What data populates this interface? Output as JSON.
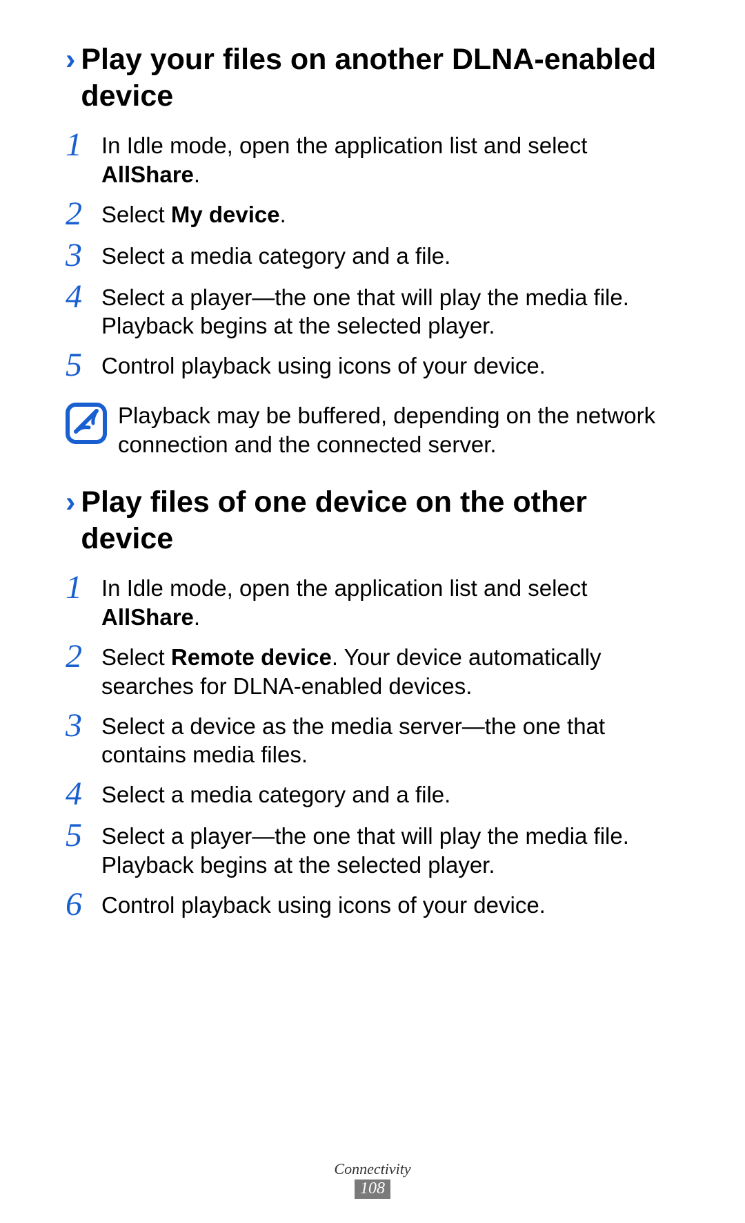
{
  "section1": {
    "heading": "Play your files on another DLNA-enabled device",
    "steps": [
      {
        "n": "1",
        "pre": "In Idle mode, open the application list and select ",
        "bold": "AllShare",
        "post": "."
      },
      {
        "n": "2",
        "pre": "Select ",
        "bold": "My device",
        "post": "."
      },
      {
        "n": "3",
        "pre": "Select a media category and a file.",
        "bold": "",
        "post": ""
      },
      {
        "n": "4",
        "pre": "Select a player—the one that will play the media file. Playback begins at the selected player.",
        "bold": "",
        "post": ""
      },
      {
        "n": "5",
        "pre": "Control playback using icons of your device.",
        "bold": "",
        "post": ""
      }
    ],
    "note": "Playback may be buffered, depending on the network connection and the connected server."
  },
  "section2": {
    "heading": "Play files of one device on the other device",
    "steps": [
      {
        "n": "1",
        "pre": "In Idle mode, open the application list and select ",
        "bold": "AllShare",
        "post": "."
      },
      {
        "n": "2",
        "pre": "Select ",
        "bold": "Remote device",
        "post": ". Your device automatically searches for DLNA-enabled devices."
      },
      {
        "n": "3",
        "pre": "Select a device as the media server—the one that contains media files.",
        "bold": "",
        "post": ""
      },
      {
        "n": "4",
        "pre": "Select a media category and a file.",
        "bold": "",
        "post": ""
      },
      {
        "n": "5",
        "pre": "Select a player—the one that will play the media file. Playback begins at the selected player.",
        "bold": "",
        "post": ""
      },
      {
        "n": "6",
        "pre": "Control playback using icons of your device.",
        "bold": "",
        "post": ""
      }
    ]
  },
  "footer": {
    "section": "Connectivity",
    "page": "108"
  },
  "chevron": "›"
}
